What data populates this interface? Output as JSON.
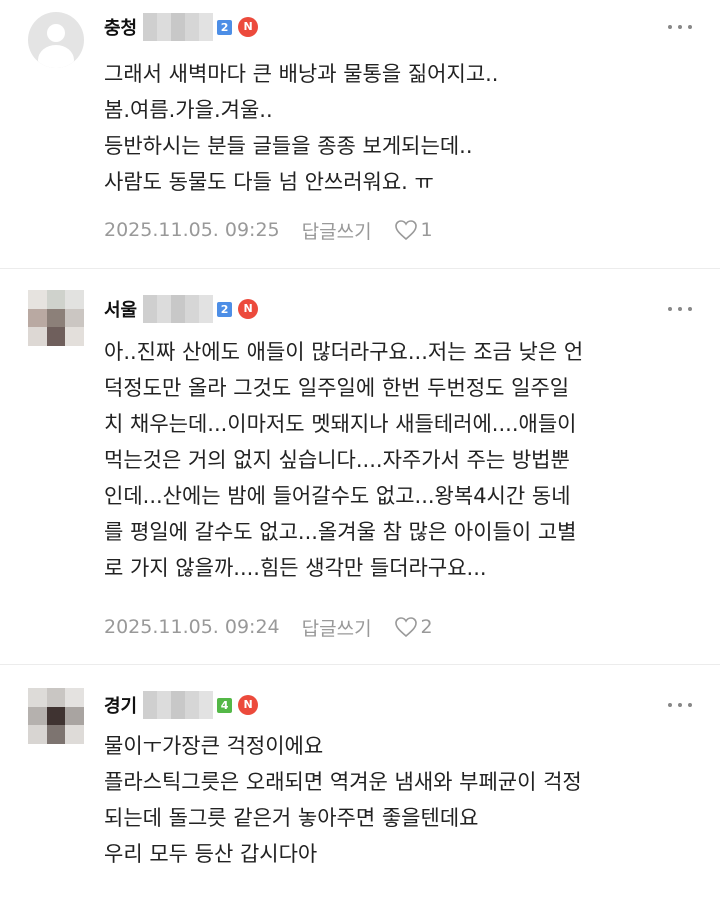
{
  "comments": [
    {
      "region": "충청",
      "level": "2",
      "n_badge": "N",
      "lines": [
        "그래서 새벽마다 큰 배낭과 물통을 짊어지고..",
        "봄.여름.가을.겨울..",
        "등반하시는 분들 글들을 종종 보게되는데..",
        "사람도 동물도 다들 넘 안쓰러워요. ㅠ"
      ],
      "timestamp": "2025.11.05. 09:25",
      "reply_label": "답글쓰기",
      "likes": "1"
    },
    {
      "region": "서울",
      "level": "2",
      "n_badge": "N",
      "lines": [
        "아..진짜 산에도 애들이 많더라구요...저는 조금 낮은 언",
        "덕정도만 올라 그것도 일주일에 한번 두번정도 일주일",
        "치 채우는데...이마저도 멧돼지나 새들테러에....애들이",
        "먹는것은 거의 없지 싶습니다....자주가서 주는 방법뿐",
        "인데...산에는 밤에 들어갈수도 없고...왕복4시간 동네",
        "를 평일에 갈수도 없고...올겨울 참 많은 아이들이 고별",
        "로 가지 않을까....힘든 생각만 들더라구요..."
      ],
      "timestamp": "2025.11.05. 09:24",
      "reply_label": "답글쓰기",
      "likes": "2"
    },
    {
      "region": "경기",
      "level": "4",
      "n_badge": "N",
      "lines": [
        "물이ㅜ가장큰 걱정이에요",
        "플라스틱그릇은 오래되면 역겨운 냄새와 부페균이 걱정",
        "되는데 돌그릇 같은거 놓아주면 좋을텐데요",
        "우리 모두 등산 갑시다아"
      ]
    }
  ],
  "colors": {
    "level_blue": "#4d8ee6",
    "level_green": "#54b847",
    "n_badge": "#ec4a3c",
    "meta_text": "#999999"
  },
  "icons": {
    "avatar_default": "default-person-avatar",
    "more": "more-dots-icon",
    "like": "heart-outline-icon"
  }
}
